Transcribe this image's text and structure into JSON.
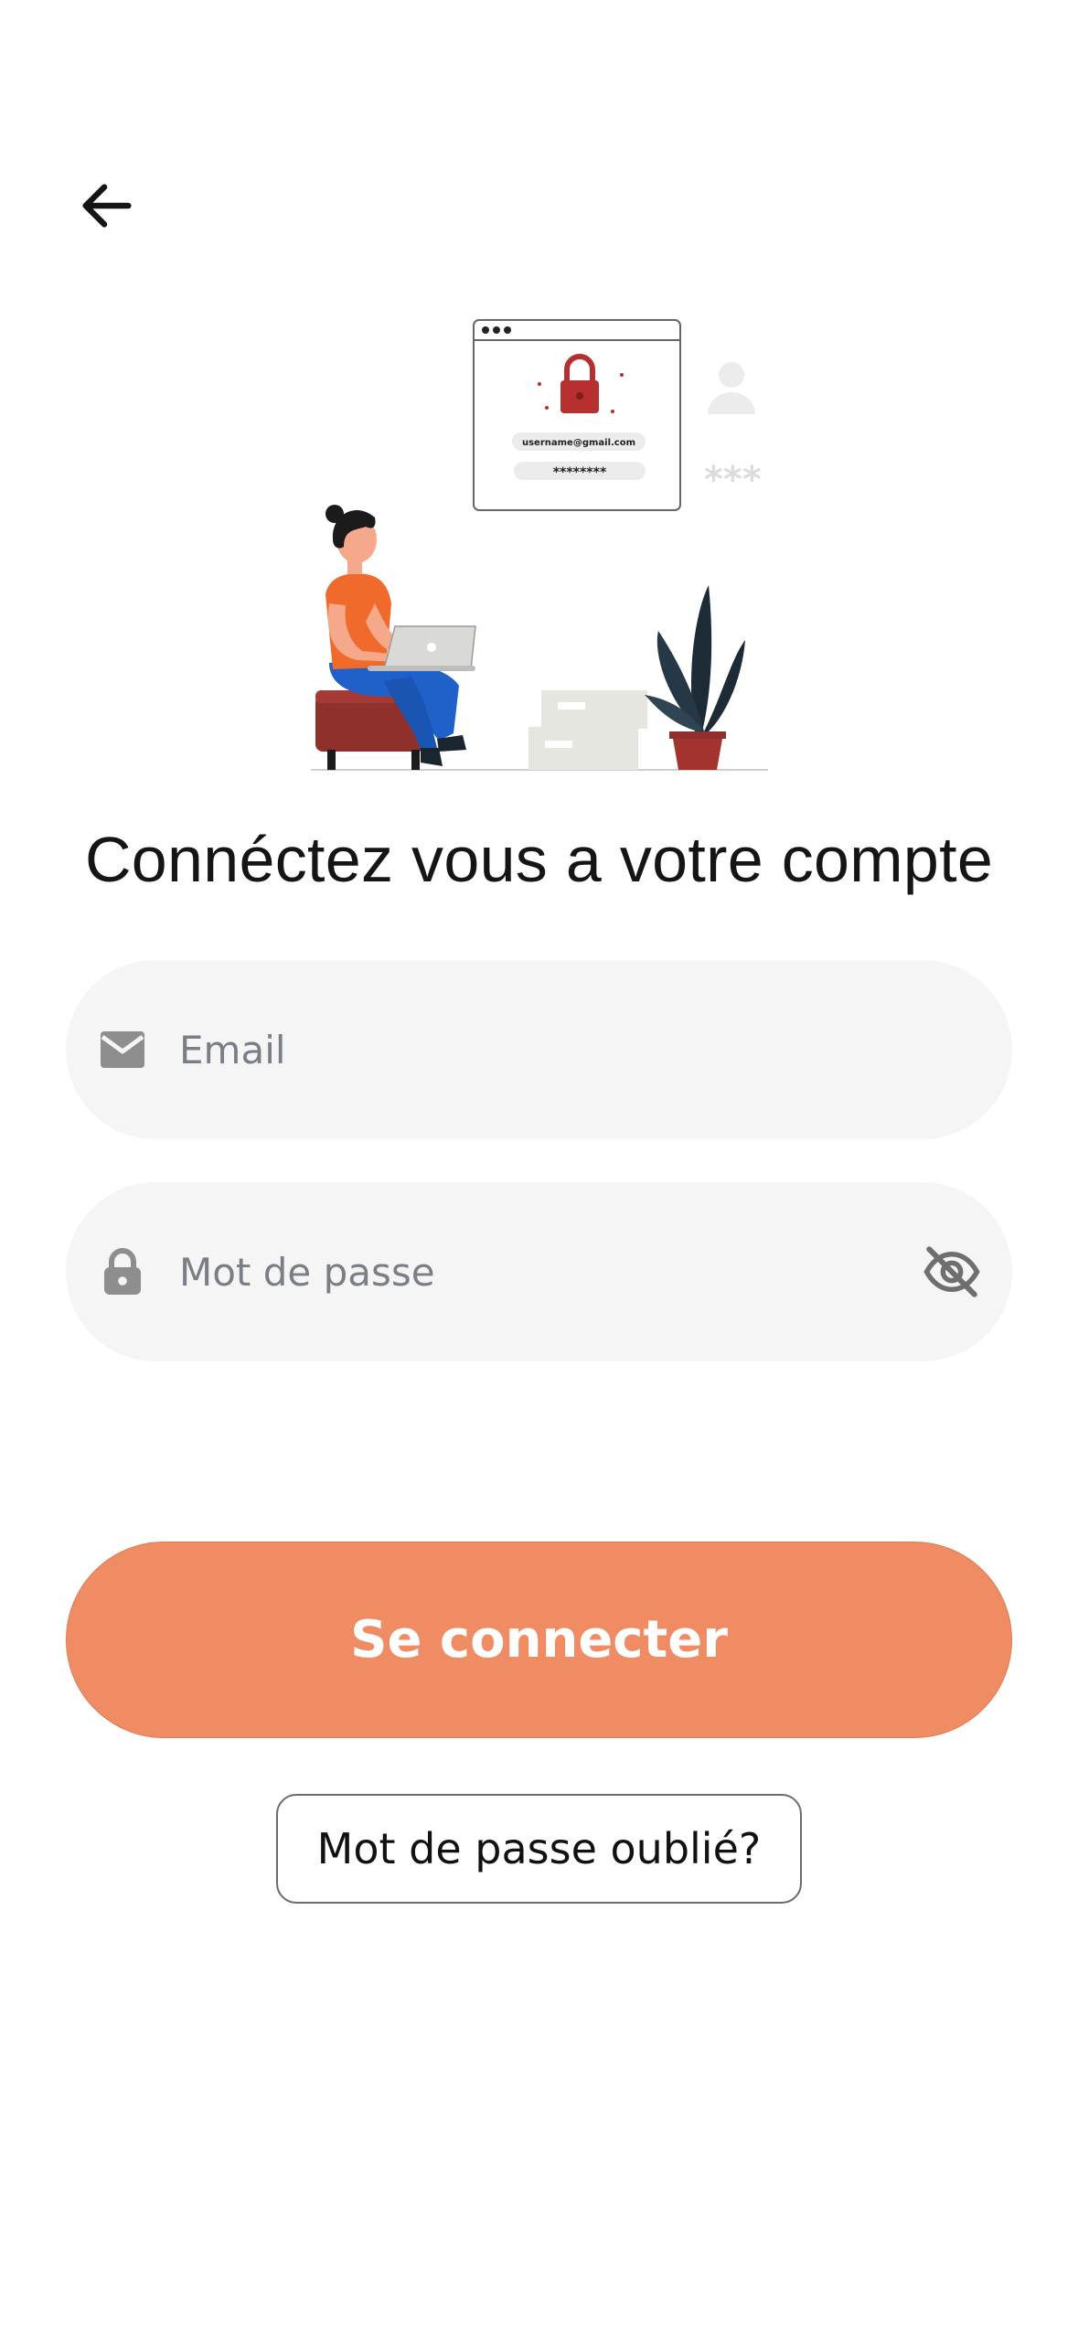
{
  "icons": {
    "back": "arrow-left-icon",
    "email": "envelope-icon",
    "password": "lock-icon",
    "visibility": "eye-off-icon"
  },
  "illustration": {
    "username_text": "username@gmail.com",
    "password_text": "********",
    "stars_text": "***"
  },
  "title": "Connéctez vous a votre compte",
  "email_field": {
    "placeholder": "Email",
    "value": ""
  },
  "password_field": {
    "placeholder": "Mot de passe",
    "value": ""
  },
  "login_button": {
    "label": "Se connecter"
  },
  "forgot_button": {
    "label": "Mot de passe oublié?"
  },
  "colors": {
    "accent": "#ef8c64",
    "field_background": "#f5f5f5",
    "placeholder": "#7a7f87",
    "icon_gray": "#8e8e8e"
  }
}
